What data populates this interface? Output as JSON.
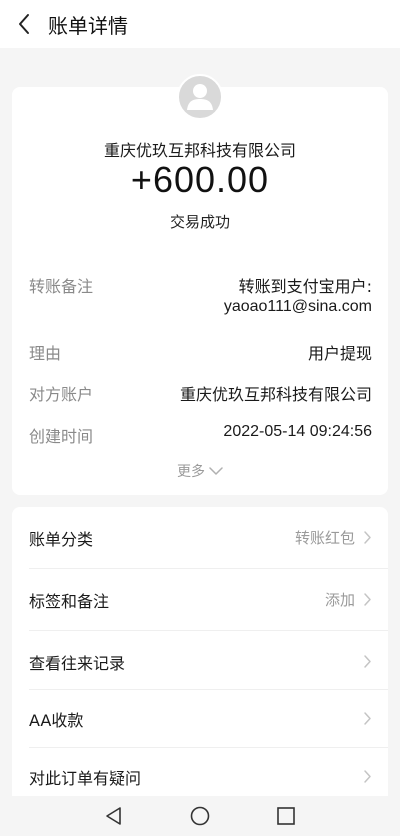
{
  "header": {
    "title": "账单详情",
    "back_icon": "chevron-left-icon"
  },
  "summary": {
    "avatar_icon": "default-user-avatar-icon",
    "payee": "重庆优玖互邦科技有限公司",
    "amount": "+600.00",
    "status": "交易成功"
  },
  "details": [
    {
      "label": "转账备注",
      "value_line1": "转账到支付宝用户:",
      "value_line2": "yaoao111@sina.com"
    },
    {
      "label": "理由",
      "value": "用户提现"
    },
    {
      "label": "对方账户",
      "value": "重庆优玖互邦科技有限公司"
    },
    {
      "label": "创建时间",
      "value": "2022-05-14 09:24:56"
    }
  ],
  "more": {
    "label": "更多",
    "icon": "chevron-down-icon"
  },
  "actions": [
    {
      "label": "账单分类",
      "value": "转账红包",
      "icon": "chevron-right-icon"
    },
    {
      "label": "标签和备注",
      "value": "添加",
      "icon": "chevron-right-icon"
    },
    {
      "label": "查看往来记录",
      "value": "",
      "icon": "chevron-right-icon"
    },
    {
      "label": "AA收款",
      "value": "",
      "icon": "chevron-right-icon"
    },
    {
      "label": "对此订单有疑问",
      "value": "",
      "icon": "chevron-right-icon"
    }
  ],
  "navbar": {
    "back_icon": "nav-back-triangle-icon",
    "home_icon": "nav-home-circle-icon",
    "recents_icon": "nav-recents-square-icon"
  },
  "colors": {
    "background": "#f5f5f5",
    "card": "#ffffff",
    "label_gray": "#8a8a8a",
    "text_dark": "#1a1a1a"
  }
}
